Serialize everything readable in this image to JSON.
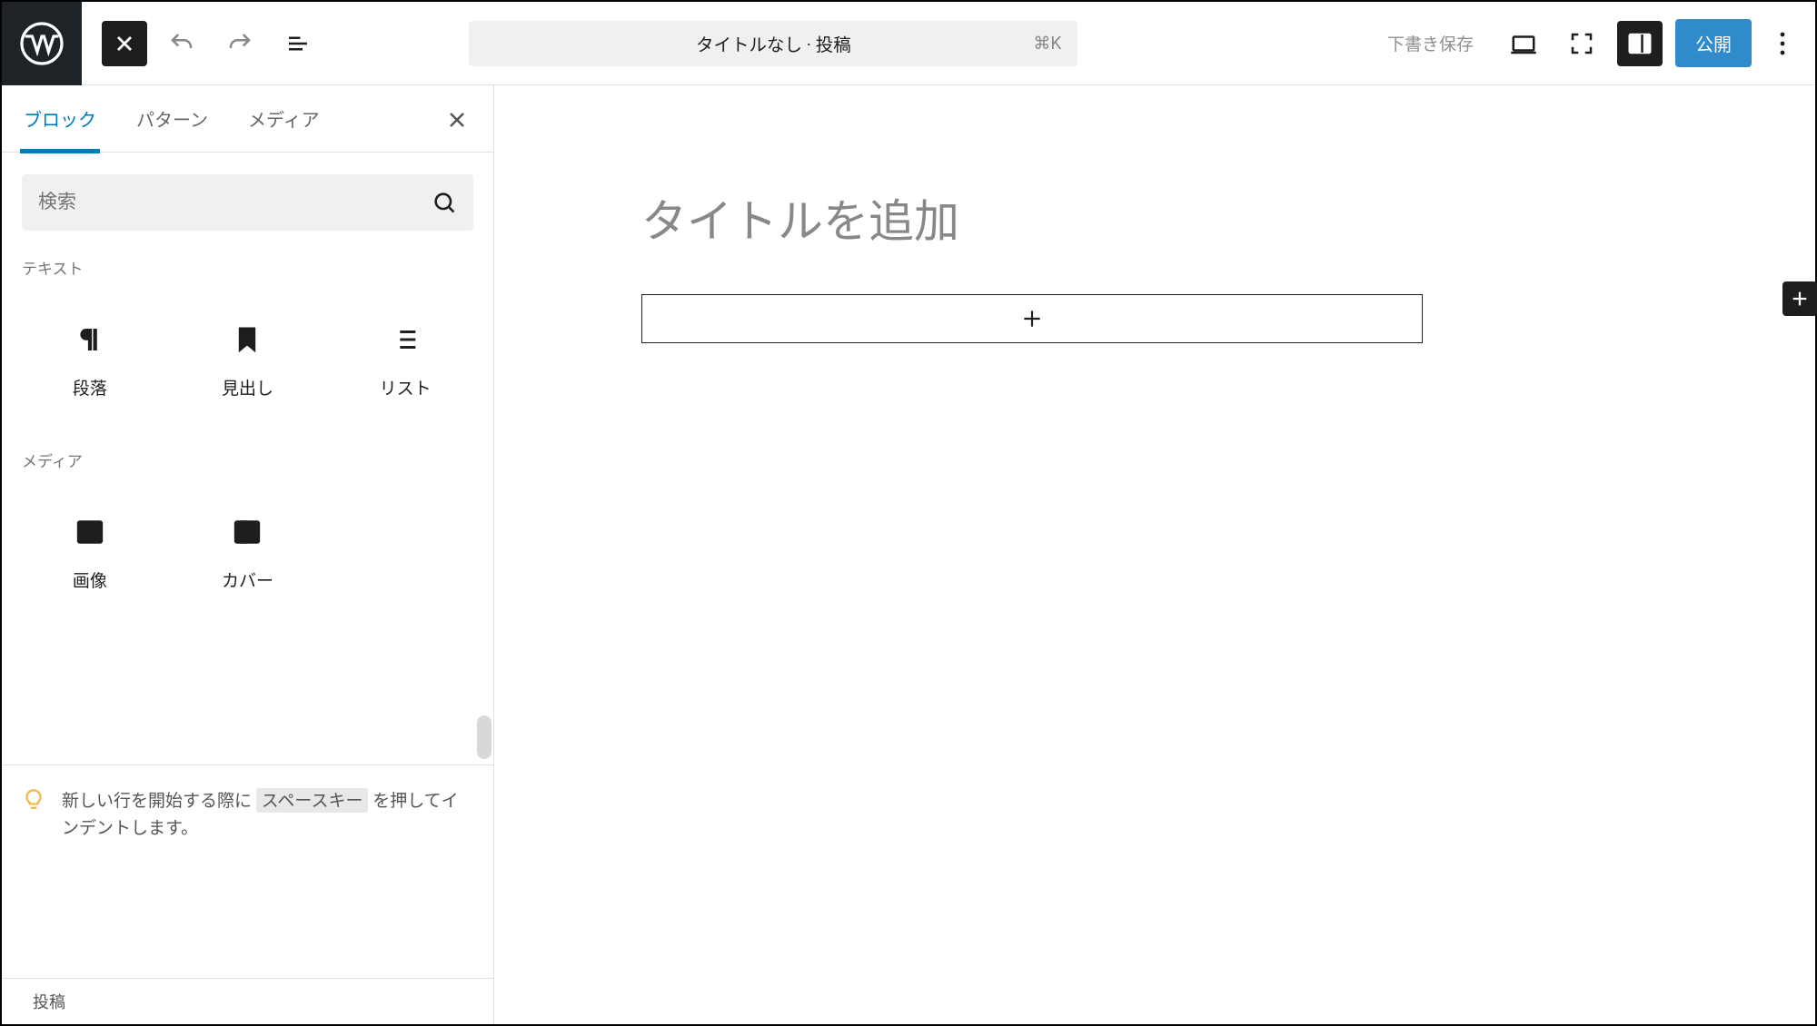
{
  "topbar": {
    "doc_title": "タイトルなし · 投稿",
    "shortcut": "⌘K",
    "save_draft": "下書き保存",
    "publish": "公開"
  },
  "inserter": {
    "tabs": {
      "blocks": "ブロック",
      "patterns": "パターン",
      "media": "メディア"
    },
    "search_placeholder": "検索",
    "sections": {
      "text": "テキスト",
      "media": "メディア"
    },
    "blocks_text": [
      {
        "id": "paragraph",
        "label": "段落"
      },
      {
        "id": "heading",
        "label": "見出し"
      },
      {
        "id": "list",
        "label": "リスト"
      }
    ],
    "blocks_media": [
      {
        "id": "image",
        "label": "画像"
      },
      {
        "id": "cover",
        "label": "カバー"
      }
    ],
    "tip_prefix": "新しい行を開始する際に",
    "tip_kbd": "スペースキー",
    "tip_suffix": "を押してインデントします。"
  },
  "canvas": {
    "title_placeholder": "タイトルを追加"
  },
  "footer": {
    "post_type": "投稿"
  }
}
